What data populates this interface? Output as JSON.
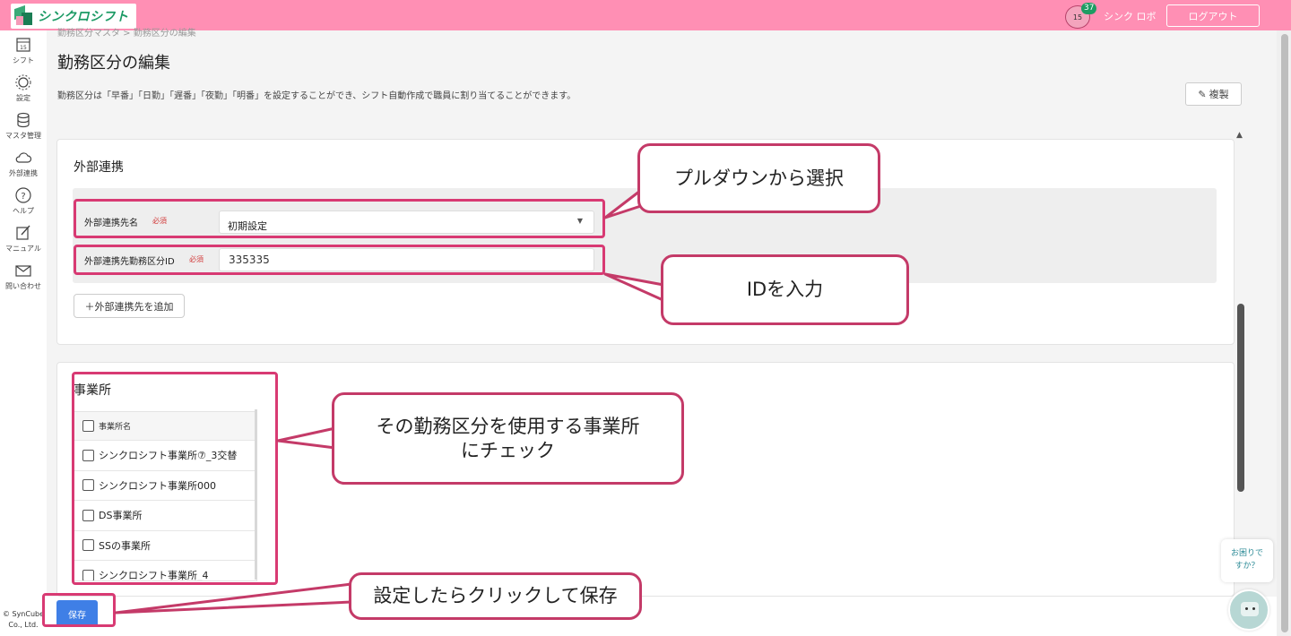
{
  "header": {
    "app_name": "シンクロシフト",
    "notification_count": "37",
    "calendar_day": "15",
    "user_name": "シンク ロボ",
    "logout_label": "ログアウト"
  },
  "sidebar": {
    "items": [
      {
        "label": "シフト",
        "icon": "calendar-icon"
      },
      {
        "label": "設定",
        "icon": "gear-icon"
      },
      {
        "label": "マスタ管理",
        "icon": "database-icon"
      },
      {
        "label": "外部連携",
        "icon": "cloud-link-icon"
      },
      {
        "label": "ヘルプ",
        "icon": "help-icon"
      },
      {
        "label": "マニュアル",
        "icon": "manual-icon"
      },
      {
        "label": "問い合わせ",
        "icon": "mail-icon"
      }
    ],
    "copyright_line1": "© SynCube",
    "copyright_line2": "Co., Ltd."
  },
  "page": {
    "breadcrumb": "勤務区分マスタ > 勤務区分の編集",
    "title": "勤務区分の編集",
    "description": "勤務区分は「早番」「日勤」「遅番」「夜勤」「明番」を設定することができ、シフト自動作成で職員に割り当てることができます。",
    "copy_button": "複製"
  },
  "external_link": {
    "section_title": "外部連携",
    "name_label": "外部連携先名",
    "required_label": "必須",
    "name_value": "初期設定",
    "id_label": "外部連携先勤務区分ID",
    "id_value": "335335",
    "add_button": "＋外部連携先を追加"
  },
  "offices": {
    "section_title": "事業所",
    "header": "事業所名",
    "rows": [
      "シンクロシフト事業所⑦_3交替",
      "シンクロシフト事業所000",
      "DS事業所",
      "SSの事業所",
      "シンクロシフト事業所_4"
    ]
  },
  "footer": {
    "save_button": "保存"
  },
  "help_widget": {
    "line1": "お困りで",
    "line2": "すか？"
  },
  "annotations": {
    "select_callout": "プルダウンから選択",
    "id_callout": "IDを入力",
    "office_callout_line1": "その勤務区分を使用する事業所",
    "office_callout_line2": "にチェック",
    "save_callout": "設定したらクリックして保存"
  },
  "colors": {
    "header_bg": "#ff8fb4",
    "annotation": "#d83a73",
    "primary_button": "#3f7fe6",
    "brand_green": "#1b9a64"
  }
}
